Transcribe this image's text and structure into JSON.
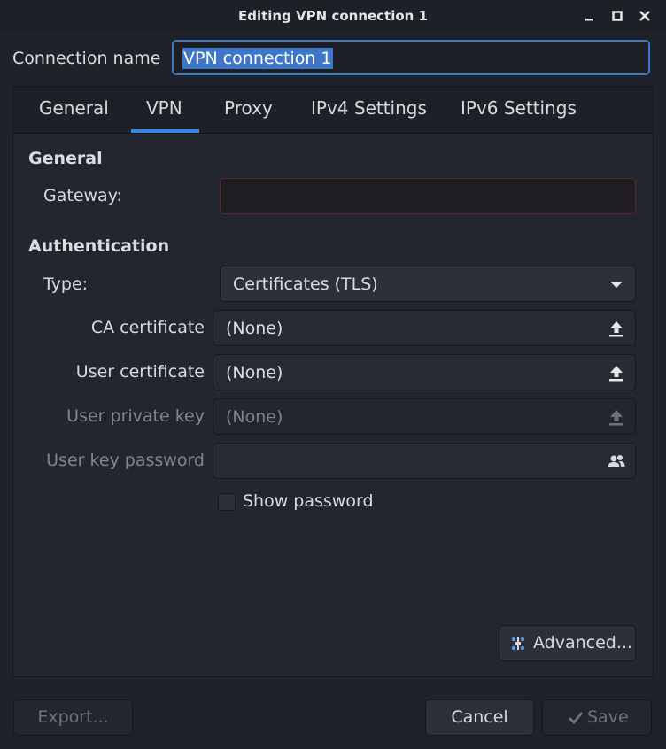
{
  "window": {
    "title": "Editing VPN connection 1",
    "controls": {
      "minimize": "minimize-icon",
      "maximize": "maximize-icon",
      "close": "close-icon"
    }
  },
  "connection": {
    "label": "Connection name",
    "value": "VPN connection 1"
  },
  "tabs": [
    {
      "label": "General",
      "active": false
    },
    {
      "label": "VPN",
      "active": true
    },
    {
      "label": "Proxy",
      "active": false
    },
    {
      "label": "IPv4 Settings",
      "active": false
    },
    {
      "label": "IPv6 Settings",
      "active": false
    }
  ],
  "general": {
    "section_title": "General",
    "gateway_label": "Gateway:",
    "gateway_value": ""
  },
  "auth": {
    "section_title": "Authentication",
    "type_label": "Type:",
    "type_value": "Certificates (TLS)",
    "ca_label": "CA certificate",
    "ca_value": "(None)",
    "user_cert_label": "User certificate",
    "user_cert_value": "(None)",
    "private_key_label": "User private key",
    "private_key_value": "(None)",
    "key_password_label": "User key password",
    "key_password_value": "",
    "show_password_label": "Show password",
    "show_password_checked": false
  },
  "buttons": {
    "advanced": "Advanced...",
    "export": "Export...",
    "cancel": "Cancel",
    "save": "Save"
  },
  "colors": {
    "accent": "#3e84dd",
    "selection": "#3e77c8",
    "error_border": "#5b2730"
  }
}
